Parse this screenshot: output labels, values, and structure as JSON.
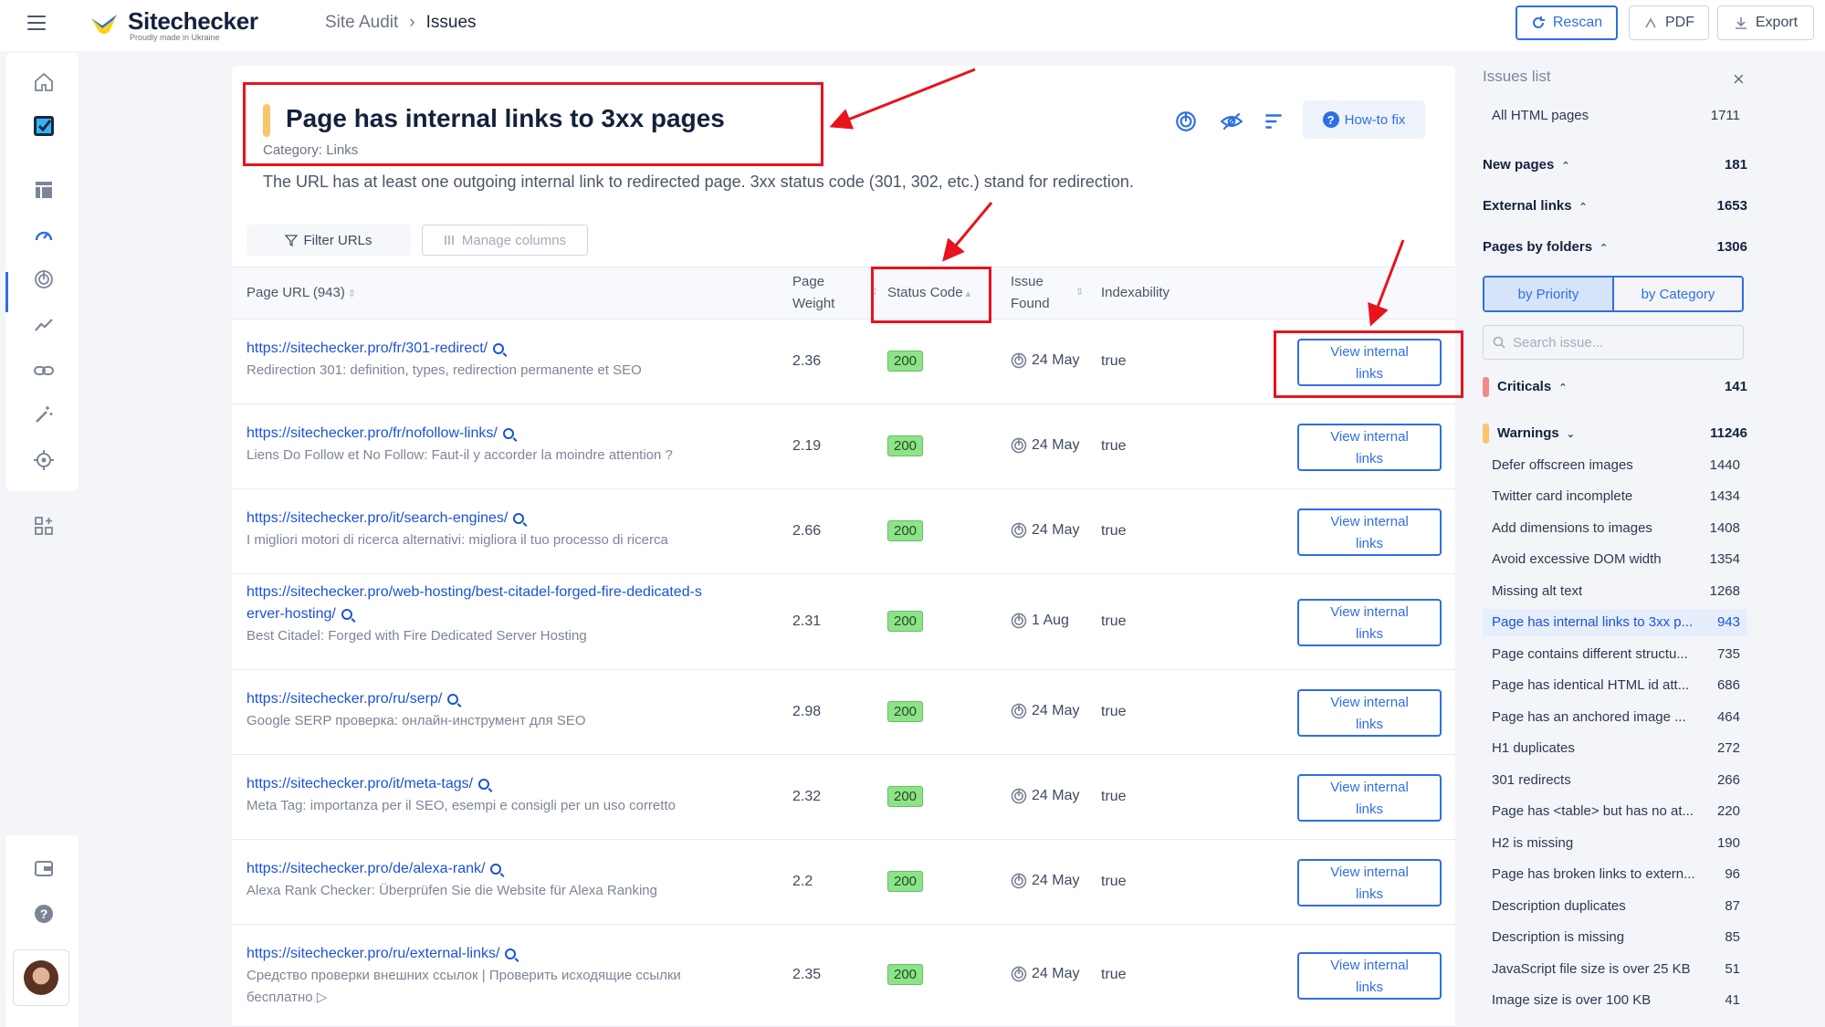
{
  "app": {
    "name": "Sitechecker",
    "tagline": "Proudly made in Ukraine"
  },
  "breadcrumb": {
    "parent": "Site Audit",
    "separator": "›",
    "current": "Issues"
  },
  "toolbar": {
    "rescan": "Rescan",
    "pdf": "PDF",
    "export": "Export"
  },
  "issue": {
    "title": "Page has internal links to 3xx pages",
    "category": "Category: Links",
    "description": "The URL has at least one outgoing internal link to redirected page. 3xx status code (301, 302, etc.) stand for redirection.",
    "howto": "How-to fix"
  },
  "controls": {
    "filter": "Filter URLs",
    "manage_columns": "Manage columns"
  },
  "table": {
    "headers": {
      "url": "Page URL (943)",
      "weight_1": "Page",
      "weight_2": "Weight",
      "status": "Status Code",
      "found_1": "Issue",
      "found_2": "Found",
      "indexability": "Indexability"
    },
    "rows": [
      {
        "url": "https://sitechecker.pro/fr/301-redirect/",
        "url_2": "",
        "title": "Redirection 301: definition, types, redirection permanente et SEO",
        "title_2": "",
        "weight": "2.36",
        "status": "200",
        "found": "24 May",
        "indexability": "true",
        "action_1": "View internal",
        "action_2": "links"
      },
      {
        "url": "https://sitechecker.pro/fr/nofollow-links/",
        "url_2": "",
        "title": "Liens Do Follow et No Follow: Faut-il y accorder la moindre attention ?",
        "title_2": "",
        "weight": "2.19",
        "status": "200",
        "found": "24 May",
        "indexability": "true",
        "action_1": "View internal",
        "action_2": "links"
      },
      {
        "url": "https://sitechecker.pro/it/search-engines/",
        "url_2": "",
        "title": "I migliori motori di ricerca alternativi: migliora il tuo processo di ricerca",
        "title_2": "",
        "weight": "2.66",
        "status": "200",
        "found": "24 May",
        "indexability": "true",
        "action_1": "View internal",
        "action_2": "links"
      },
      {
        "url": "https://sitechecker.pro/web-hosting/best-citadel-forged-fire-dedicated-s",
        "url_2": "erver-hosting/",
        "title": "Best Citadel: Forged with Fire Dedicated Server Hosting",
        "title_2": "",
        "weight": "2.31",
        "status": "200",
        "found": "1 Aug",
        "indexability": "true",
        "action_1": "View internal",
        "action_2": "links"
      },
      {
        "url": "https://sitechecker.pro/ru/serp/",
        "url_2": "",
        "title": "Google SERP проверка: онлайн-инструмент для SEO",
        "title_2": "",
        "weight": "2.98",
        "status": "200",
        "found": "24 May",
        "indexability": "true",
        "action_1": "View internal",
        "action_2": "links"
      },
      {
        "url": "https://sitechecker.pro/it/meta-tags/",
        "url_2": "",
        "title": "Meta Tag: importanza per il SEO, esempi e consigli per un uso corretto",
        "title_2": "",
        "weight": "2.32",
        "status": "200",
        "found": "24 May",
        "indexability": "true",
        "action_1": "View internal",
        "action_2": "links"
      },
      {
        "url": "https://sitechecker.pro/de/alexa-rank/",
        "url_2": "",
        "title": "Alexa Rank Checker: Überprüfen Sie die Website für Alexa Ranking",
        "title_2": "",
        "weight": "2.2",
        "status": "200",
        "found": "24 May",
        "indexability": "true",
        "action_1": "View internal",
        "action_2": "links"
      },
      {
        "url": "https://sitechecker.pro/ru/external-links/",
        "url_2": "",
        "title": "Средство проверки внешних ссылок | Проверить исходящие ссылки",
        "title_2": "бесплатно ▷",
        "weight": "2.35",
        "status": "200",
        "found": "24 May",
        "indexability": "true",
        "action_1": "View internal",
        "action_2": "links"
      }
    ]
  },
  "sidebar": {
    "title": "Issues list",
    "close": "×",
    "all": {
      "label": "All HTML pages",
      "count": "1711"
    },
    "groups": [
      {
        "label": "New pages",
        "count": "181"
      },
      {
        "label": "External links",
        "count": "1653"
      },
      {
        "label": "Pages by folders",
        "count": "1306"
      }
    ],
    "tabs": {
      "priority": "by Priority",
      "category": "by Category"
    },
    "search_placeholder": "Search issue...",
    "criticals": {
      "label": "Criticals",
      "count": "141",
      "color": "#f28b86"
    },
    "warnings": {
      "label": "Warnings",
      "count": "11246",
      "color": "#fbc56b"
    },
    "issues": [
      {
        "label": "Defer offscreen images",
        "count": "1440"
      },
      {
        "label": "Twitter card incomplete",
        "count": "1434"
      },
      {
        "label": "Add dimensions to images",
        "count": "1408"
      },
      {
        "label": "Avoid excessive DOM width",
        "count": "1354"
      },
      {
        "label": "Missing alt text",
        "count": "1268"
      },
      {
        "label": "Page has internal links to 3xx p...",
        "count": "943"
      },
      {
        "label": "Page contains different structu...",
        "count": "735"
      },
      {
        "label": "Page has identical HTML id att...",
        "count": "686"
      },
      {
        "label": "Page has an anchored image ...",
        "count": "464"
      },
      {
        "label": "H1 duplicates",
        "count": "272"
      },
      {
        "label": "301 redirects",
        "count": "266"
      },
      {
        "label": "Page has <table> but has no at...",
        "count": "220"
      },
      {
        "label": "H2 is missing",
        "count": "190"
      },
      {
        "label": "Page has broken links to extern...",
        "count": "96"
      },
      {
        "label": "Description duplicates",
        "count": "87"
      },
      {
        "label": "Description is missing",
        "count": "85"
      },
      {
        "label": "JavaScript file size is over 25 KB",
        "count": "51"
      },
      {
        "label": "Image size is over 100 KB",
        "count": "41"
      }
    ]
  },
  "colors": {
    "accent": "#2f6fe4",
    "link": "#1a52d9",
    "annotation": "#e8131c",
    "status_ok": "#8ee28a"
  }
}
